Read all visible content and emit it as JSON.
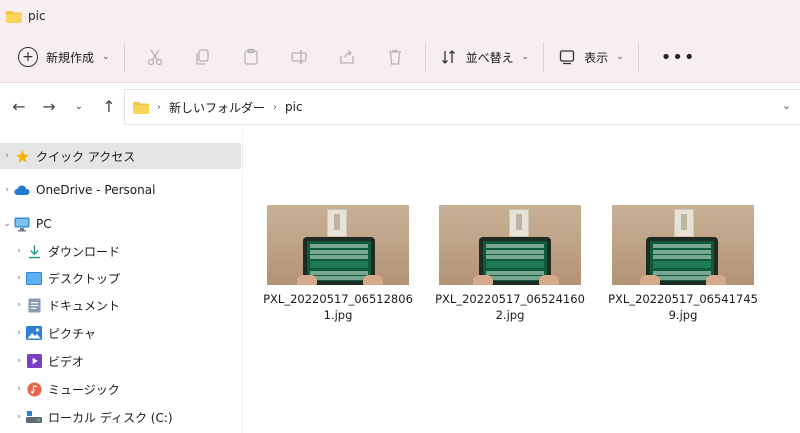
{
  "window": {
    "title": "pic"
  },
  "toolbar": {
    "new_label": "新規作成",
    "sort_label": "並べ替え",
    "view_label": "表示",
    "more_label": "•••"
  },
  "address": {
    "crumbs": [
      "新しいフォルダー",
      "pic"
    ]
  },
  "sidebar": {
    "items": [
      {
        "label": "クイック アクセス",
        "icon": "star-icon"
      },
      {
        "label": "OneDrive - Personal",
        "icon": "cloud-icon"
      },
      {
        "label": "PC",
        "icon": "monitor-icon"
      },
      {
        "label": "ダウンロード",
        "icon": "download-icon"
      },
      {
        "label": "デスクトップ",
        "icon": "desktop-icon"
      },
      {
        "label": "ドキュメント",
        "icon": "document-icon"
      },
      {
        "label": "ピクチャ",
        "icon": "pictures-icon"
      },
      {
        "label": "ビデオ",
        "icon": "video-icon"
      },
      {
        "label": "ミュージック",
        "icon": "music-icon"
      },
      {
        "label": "ローカル ディスク (C:)",
        "icon": "drive-icon"
      }
    ]
  },
  "files": [
    {
      "name": "PXL_20220517_065128061.jpg"
    },
    {
      "name": "PXL_20220517_065241602.jpg"
    },
    {
      "name": "PXL_20220517_065417459.jpg"
    }
  ],
  "colors": {
    "titlebar_bg": "#f7eef2",
    "selected_bg": "#e5e5e5",
    "folder_yellow": "#f4c542",
    "accent_blue": "#1a73e8"
  }
}
